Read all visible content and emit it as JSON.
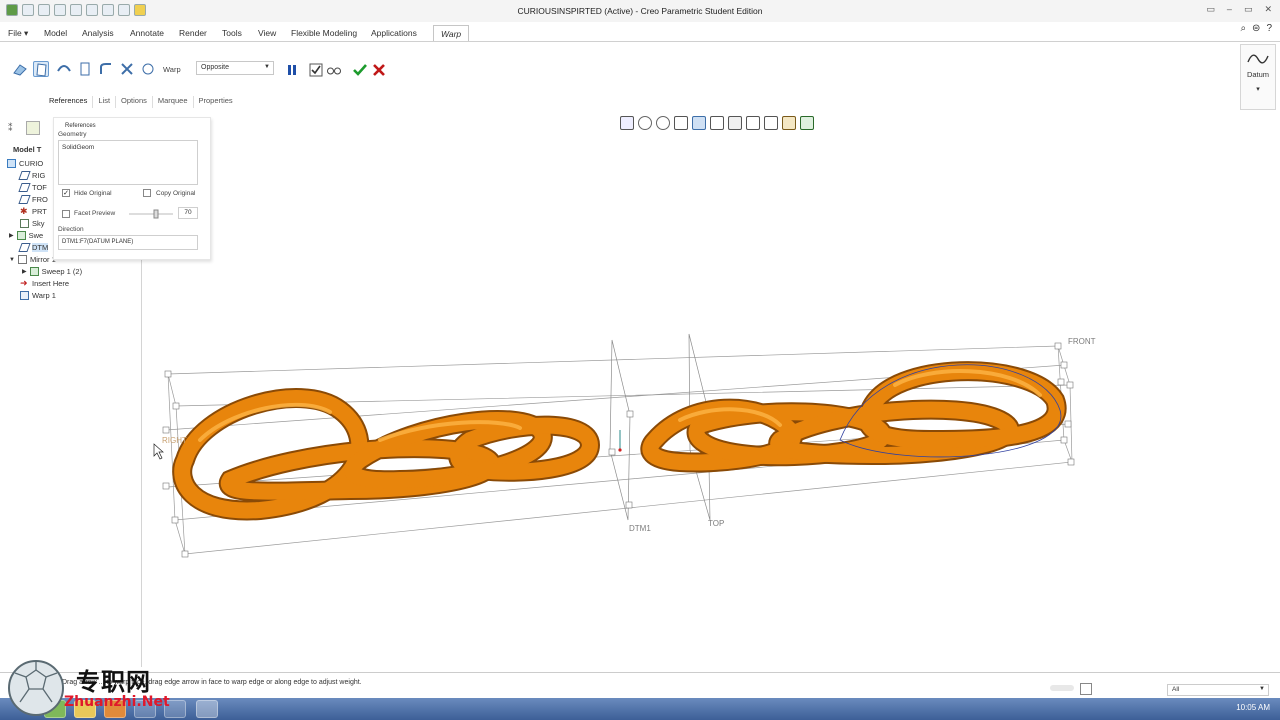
{
  "window": {
    "title": "CURIOUSINSPIRTED (Active) - Creo Parametric Student Edition",
    "controls": [
      "▭",
      "–",
      "▭",
      "✕"
    ]
  },
  "menu": {
    "tabs": [
      "File ▾",
      "Model",
      "Analysis",
      "Annotate",
      "Render",
      "Tools",
      "View",
      "Flexible Modeling",
      "Applications",
      "Warp"
    ],
    "active_tab": "Warp"
  },
  "ribbon": {
    "warp_label": "Warp",
    "option_select": "Opposite",
    "datum_label": "Datum",
    "datum_dropdown": "▾"
  },
  "dashboard_tabs": [
    "References",
    "List",
    "Options",
    "Marquee",
    "Properties"
  ],
  "references_panel": {
    "title": "References",
    "geometry_label": "Geometry",
    "geometry_value": "SolidGeom",
    "hide_original_label": "Hide Original",
    "hide_original_checked": true,
    "copy_original_label": "Copy Original",
    "copy_original_checked": false,
    "facet_preview_label": "Facet Preview",
    "facet_preview_checked": false,
    "facet_value": "70",
    "direction_label": "Direction",
    "direction_value": "DTM1:F7(DATUM PLANE)"
  },
  "model_tree": {
    "label": "Model T",
    "items": [
      {
        "label": "CURIO"
      },
      {
        "label": "RIG"
      },
      {
        "label": "TOF"
      },
      {
        "label": "FRO"
      },
      {
        "label": "PRT"
      },
      {
        "label": "Sky"
      },
      {
        "label": "Swe"
      },
      {
        "label": "DTM"
      },
      {
        "label": "Mirror 1"
      },
      {
        "label": "Sweep 1 (2)"
      },
      {
        "label": "Insert Here"
      },
      {
        "label": "Warp 1"
      }
    ]
  },
  "scene": {
    "plane_labels": {
      "front": "FRONT",
      "dtm1": "DTM1",
      "top": "TOP",
      "right": "RIGHT"
    },
    "chain_color": "#e8850c"
  },
  "status": {
    "message": "Drag arrow ... to warp face, drag edge arrow in face to warp edge or along edge to adjust weight.",
    "filter": "All"
  },
  "taskbar": {
    "clock": "10:05 AM"
  },
  "watermark": {
    "cn": "专职网",
    "en": "Zhuanzhi.Net"
  }
}
